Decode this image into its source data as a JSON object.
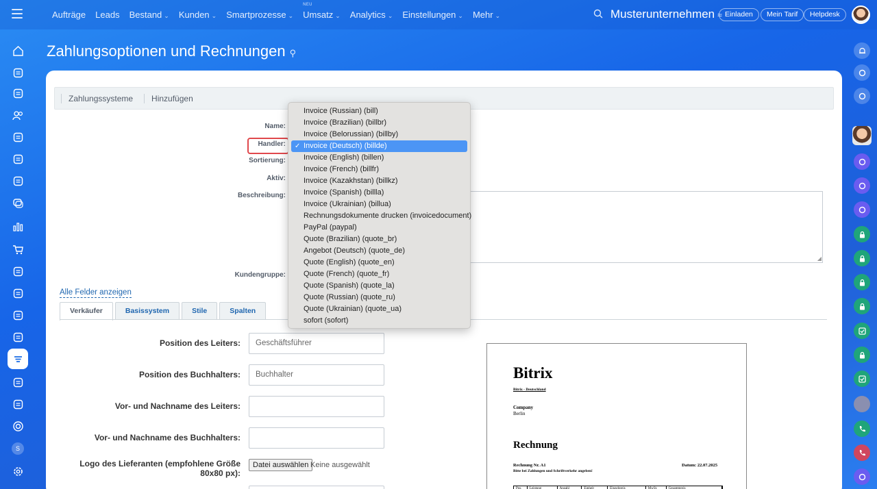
{
  "topbar": {
    "nav": [
      {
        "label": "Aufträge",
        "chevron": false,
        "neu": ""
      },
      {
        "label": "Leads",
        "chevron": false,
        "neu": ""
      },
      {
        "label": "Bestand",
        "chevron": true,
        "neu": ""
      },
      {
        "label": "Kunden",
        "chevron": true,
        "neu": ""
      },
      {
        "label": "Smartprozesse",
        "chevron": true,
        "neu": ""
      },
      {
        "label": "Umsatz",
        "chevron": true,
        "neu": "NEU"
      },
      {
        "label": "Analytics",
        "chevron": true,
        "neu": ""
      },
      {
        "label": "Einstellungen",
        "chevron": true,
        "neu": ""
      },
      {
        "label": "Mehr",
        "chevron": true,
        "neu": ""
      }
    ],
    "company": "Musterunternehmen",
    "buttons": {
      "invite": "Einladen",
      "tariff": "Mein Tarif",
      "helpdesk": "Helpdesk"
    }
  },
  "page": {
    "title": "Zahlungsoptionen und Rechnungen"
  },
  "toolbar": {
    "payment_systems": "Zahlungssysteme",
    "add": "Hinzufügen"
  },
  "form": {
    "labels": {
      "name": "Name:",
      "handler": "Handler:",
      "sort": "Sortierung:",
      "active": "Aktiv:",
      "description": "Beschreibung:",
      "customer_group": "Kundengruppe:"
    },
    "all_fields": "Alle Felder anzeigen"
  },
  "tabs": [
    "Verkäufer",
    "Basissystem",
    "Stile",
    "Spalten"
  ],
  "seller": {
    "rows": [
      {
        "label": "Position des Leiters:",
        "value": "Geschäftsführer"
      },
      {
        "label": "Position des Buchhalters:",
        "value": "Buchhalter"
      },
      {
        "label": "Vor- und Nachname des Leiters:",
        "value": ""
      },
      {
        "label": "Vor- und Nachname des Buchhalters:",
        "value": ""
      }
    ],
    "logo_label": "Logo des Lieferanten (empfohlene Größe 80x80 px):",
    "file_button": "Datei auswählen",
    "file_none": "Keine ausgewählt"
  },
  "preview": {
    "brand": "Bitrix",
    "brand_sub": "Bitrix - Deutschland",
    "company": "Company",
    "city": "Berlin",
    "title": "Rechnung",
    "number": "Rechnung Nr. A1",
    "note": "Bitte bei Zahlungen und Schriftverkehr angeben!",
    "date": "Datum: 22.07.2025",
    "columns": [
      "Pos.",
      "Leistung",
      "Anzahl",
      "Einheit",
      "Einzelpreis",
      "MwSt.",
      "Gesamtpreis"
    ]
  },
  "handler_dropdown": {
    "selected_index": 3,
    "options": [
      "Invoice (Russian) (bill)",
      "Invoice (Brazilian) (billbr)",
      "Invoice (Belorussian) (billby)",
      "Invoice (Deutsch) (billde)",
      "Invoice (English) (billen)",
      "Invoice (French) (billfr)",
      "Invoice (Kazakhstan) (billkz)",
      "Invoice (Spanish) (billla)",
      "Invoice (Ukrainian) (billua)",
      "Rechnungsdokumente drucken (invoicedocument)",
      "PayPal (paypal)",
      "Quote (Brazilian) (quote_br)",
      "Angebot (Deutsch) (quote_de)",
      "Quote (English) (quote_en)",
      "Quote (French) (quote_fr)",
      "Quote (Spanish) (quote_la)",
      "Quote (Russian) (quote_ru)",
      "Quote (Ukrainian) (quote_ua)",
      "sofort (sofort)"
    ]
  },
  "sidebar_left": {
    "icons": [
      "home-icon",
      "automation-icon",
      "tasks-icon",
      "contacts-icon",
      "documents-icon",
      "payment-icon",
      "sites-icon",
      "chat-icon",
      "analytics-icon",
      "shop-icon",
      "sign-icon",
      "storage-icon",
      "booking-icon",
      "contact-center-icon",
      "crm-settings-icon",
      "calendar-icon",
      "bot-icon",
      "target-icon"
    ],
    "badge": "S",
    "settings_icon": "settings-icon"
  },
  "sidebar_right": {
    "icons": [
      "notification-icon",
      "copilot-icon",
      "chat-search-icon",
      "user-avatar",
      "channel-icon",
      "channel-icon",
      "channel-icon",
      "lock-icon",
      "lock-icon",
      "lock-icon",
      "lock-icon",
      "check-icon",
      "lock-icon",
      "check-icon",
      "team-avatar",
      "phone-icon",
      "phone-icon",
      "channel-icon"
    ]
  },
  "colors": {
    "accent": "#1f6fe5",
    "selected": "#4c95f5",
    "highlight": "#e0484c",
    "link": "#2067b0"
  }
}
